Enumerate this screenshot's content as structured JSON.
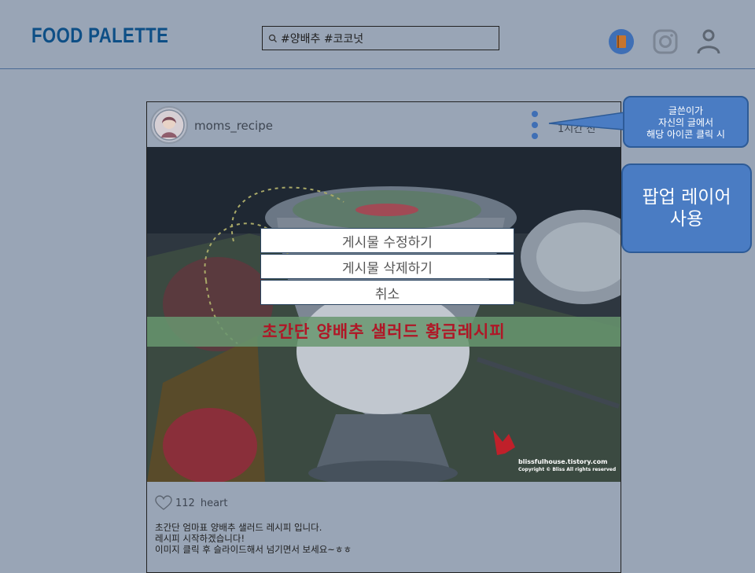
{
  "header": {
    "logo": "FOOD PALETTE",
    "search_value": "#양배추 #코코넛",
    "icons": [
      "notebook-icon",
      "instagram-icon",
      "user-icon"
    ]
  },
  "post": {
    "username": "moms_recipe",
    "time": "1시간 전",
    "image_banner": "초간단 양배추 샐러드 황금레시피",
    "watermark": "blissfulhouse.tistory.com",
    "watermark_copyright": "Copyright © Bliss All rights reserved",
    "likes_count": "112",
    "likes_label": "heart",
    "caption": [
      "초간단 엄마표 양배추 샐러드 레시피 입니다.",
      "레시피 시작하겠습니다!",
      "이미지 클릭 후 슬라이드해서 넘기면서 보세요~ㅎㅎ"
    ]
  },
  "popup_menu": {
    "edit": "게시물 수정하기",
    "delete": "게시물 삭제하기",
    "cancel": "취소"
  },
  "annotations": {
    "note_lines": [
      "글쓴이가",
      "자신의 글에서",
      "해당 아이콘 클릭 시"
    ],
    "popup_lines": [
      "팝업 레이어",
      "사용"
    ]
  },
  "colors": {
    "overlay_bg": "#99a5b6",
    "logo": "#0e4f86",
    "callout": "#4a7cc3",
    "dots": "#3f6fb5"
  }
}
